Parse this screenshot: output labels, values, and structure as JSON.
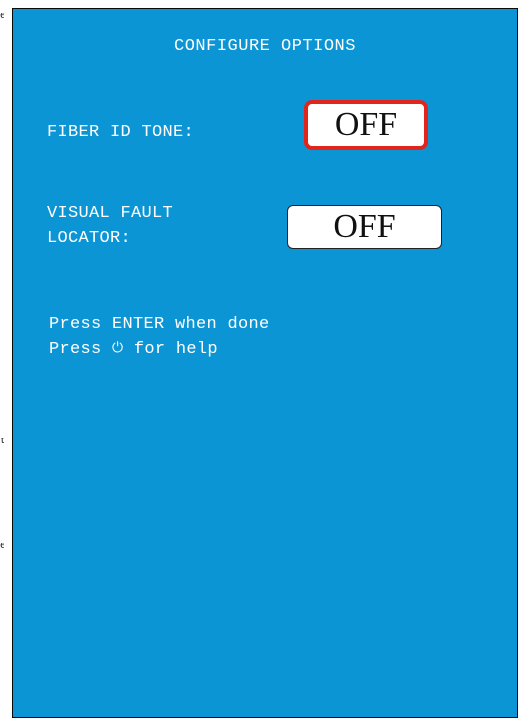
{
  "screen": {
    "title": "CONFIGURE OPTIONS",
    "background_color": "#0c95d4",
    "selection_color": "#e1251b"
  },
  "options": [
    {
      "label_line1": "FIBER ID TONE:",
      "label_line2": "",
      "value": "OFF",
      "selected": true
    },
    {
      "label_line1": "VISUAL FAULT",
      "label_line2": "LOCATOR:",
      "value": "OFF",
      "selected": false
    }
  ],
  "instructions": {
    "line1": "Press ENTER when done",
    "line2_prefix": "Press ",
    "line2_icon": "power-icon",
    "line2_icon_glyph": "⏻",
    "line2_suffix": " for help"
  },
  "edge_marks": {
    "top": "e",
    "middle": "t",
    "bottom": "e"
  }
}
